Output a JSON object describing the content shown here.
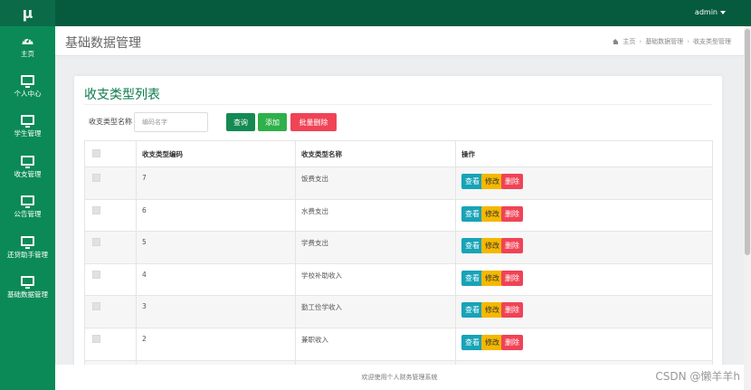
{
  "logo": "μ",
  "user": {
    "name": "admin"
  },
  "sidebar": {
    "items": [
      {
        "label": "主页",
        "icon": "dashboard-icon"
      },
      {
        "label": "个人中心",
        "icon": "monitor-icon"
      },
      {
        "label": "学生管理",
        "icon": "monitor-icon"
      },
      {
        "label": "收支管理",
        "icon": "monitor-icon"
      },
      {
        "label": "公告管理",
        "icon": "monitor-icon"
      },
      {
        "label": "还贷助手管理",
        "icon": "monitor-icon"
      },
      {
        "label": "基础数据管理",
        "icon": "monitor-icon"
      }
    ]
  },
  "header": {
    "title": "基础数据管理",
    "breadcrumb": [
      "主页",
      "基础数据管理",
      "收支类型管理"
    ]
  },
  "card": {
    "title": "收支类型列表",
    "search": {
      "label": "收支类型名称",
      "placeholder": "编码名字"
    },
    "buttons": {
      "query": "查询",
      "add": "添加",
      "batch_delete": "批量删除"
    }
  },
  "table": {
    "columns": [
      "",
      "收支类型编码",
      "收支类型名称",
      "操作"
    ],
    "rows": [
      {
        "code": "7",
        "name": "饭费支出"
      },
      {
        "code": "6",
        "name": "水费支出"
      },
      {
        "code": "5",
        "name": "学费支出"
      },
      {
        "code": "4",
        "name": "学校补助收入"
      },
      {
        "code": "3",
        "name": "勤工俭学收入"
      },
      {
        "code": "2",
        "name": "兼职收入"
      },
      {
        "code": "",
        "name": ""
      }
    ],
    "actions": {
      "view": "查看",
      "edit": "修改",
      "delete": "删除"
    }
  },
  "footer": {
    "text": "欢迎使用个人财务管理系统"
  },
  "watermark": "CSDN @懒羊羊h",
  "colors": {
    "topbar": "#065b3e",
    "sidebar": "#0b8a57",
    "accent_green": "#0b7a4d",
    "query": "#148a52",
    "add": "#2eb04a",
    "danger": "#f04356",
    "info": "#17a3b8",
    "warning": "#f5b800"
  }
}
